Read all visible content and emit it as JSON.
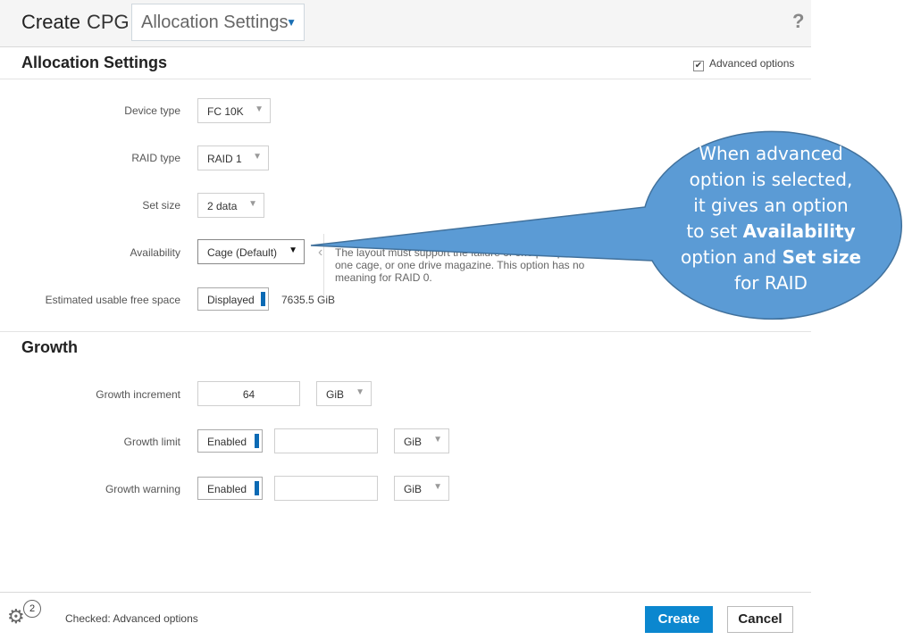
{
  "header": {
    "title_create": "Create",
    "title_cpg": "CPG",
    "section_select": "Allocation Settings",
    "help": "?"
  },
  "allocation": {
    "heading": "Allocation Settings",
    "advanced_options_label": "Advanced options",
    "advanced_checked": true,
    "device_type": {
      "label": "Device type",
      "value": "FC 10K"
    },
    "raid_type": {
      "label": "RAID type",
      "value": "RAID 1"
    },
    "set_size": {
      "label": "Set size",
      "value": "2 data"
    },
    "availability": {
      "label": "Availability",
      "value": "Cage (Default)",
      "help": "The layout must support the failure of one port pair, one cage, or one drive magazine. This option has no meaning for RAID 0."
    },
    "free_space": {
      "label": "Estimated usable free space",
      "toggle": "Displayed",
      "value": "7635.5 GiB"
    }
  },
  "growth": {
    "heading": "Growth",
    "increment": {
      "label": "Growth increment",
      "value": "64",
      "unit": "GiB"
    },
    "limit": {
      "label": "Growth limit",
      "toggle": "Enabled",
      "value": "",
      "unit": "GiB"
    },
    "warning": {
      "label": "Growth warning",
      "toggle": "Enabled",
      "value": "",
      "unit": "GiB"
    }
  },
  "footer": {
    "badge_count": "2",
    "status": "Checked: Advanced options",
    "create": "Create",
    "cancel": "Cancel"
  },
  "callout": {
    "line1": "When advanced",
    "line2": "option is selected,",
    "line3": "it gives an option",
    "line4_pre": "to set ",
    "line4_bold": "Availability",
    "line5_pre": "option and ",
    "line5_bold": "Set size",
    "line6": "for RAID",
    "fill": "#5b9bd5",
    "stroke": "#41719c"
  },
  "colors": {
    "accent": "#0b87cf",
    "toggle_bar": "#0b6ab4"
  }
}
